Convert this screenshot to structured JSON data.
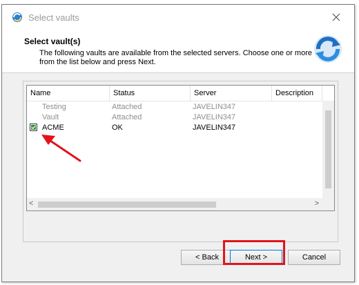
{
  "window": {
    "title": "Select vaults"
  },
  "header": {
    "title": "Select vault(s)",
    "description": "The following vaults are available from the selected servers. Choose one or more from the list below and press Next."
  },
  "list": {
    "columns": [
      "Name",
      "Status",
      "Server",
      "Description"
    ],
    "rows": [
      {
        "name": "Testing",
        "status": "Attached",
        "server": "JAVELIN347",
        "checked": false,
        "dimmed": true
      },
      {
        "name": "Vault",
        "status": "Attached",
        "server": "JAVELIN347",
        "checked": false,
        "dimmed": true
      },
      {
        "name": "ACME",
        "status": "OK",
        "server": "JAVELIN347",
        "checked": true,
        "dimmed": false
      }
    ],
    "scroll_left_glyph": "<",
    "scroll_right_glyph": ">"
  },
  "buttons": {
    "back": "< Back",
    "next": "Next >",
    "cancel": "Cancel"
  },
  "colors": {
    "annotation_red": "#e0141a",
    "checkbox_green": "#2f8f2f"
  },
  "icons": [
    "app-icon",
    "close-icon",
    "refresh-arrows-icon",
    "checkbox-icon",
    "annotation-arrow-icon"
  ]
}
